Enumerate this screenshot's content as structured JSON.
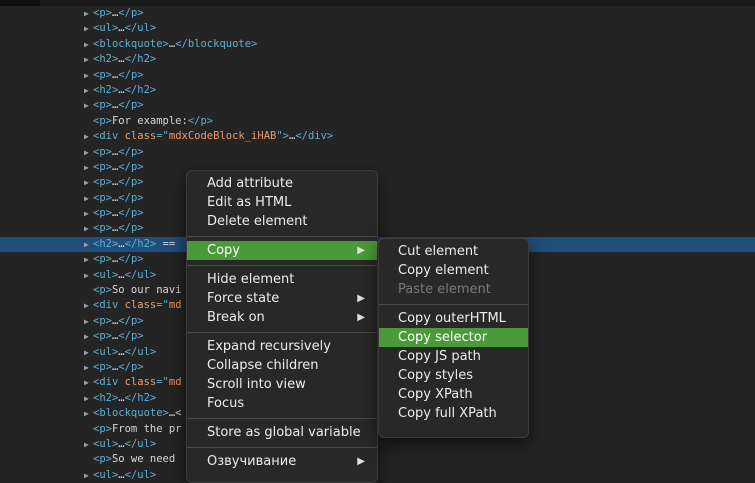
{
  "dom_lines": [
    {
      "arrow": true,
      "parts": [
        [
          "t",
          "<p>"
        ],
        [
          "txt",
          "…"
        ],
        [
          "t",
          "</p>"
        ]
      ]
    },
    {
      "arrow": true,
      "parts": [
        [
          "t",
          "<ul>"
        ],
        [
          "txt",
          "…"
        ],
        [
          "t",
          "</ul>"
        ]
      ]
    },
    {
      "arrow": true,
      "parts": [
        [
          "t",
          "<blockquote>"
        ],
        [
          "txt",
          "…"
        ],
        [
          "t",
          "</blockquote>"
        ]
      ]
    },
    {
      "arrow": true,
      "parts": [
        [
          "t",
          "<h2>"
        ],
        [
          "txt",
          "…"
        ],
        [
          "t",
          "</h2>"
        ]
      ]
    },
    {
      "arrow": true,
      "parts": [
        [
          "t",
          "<p>"
        ],
        [
          "txt",
          "…"
        ],
        [
          "t",
          "</p>"
        ]
      ]
    },
    {
      "arrow": true,
      "parts": [
        [
          "t",
          "<h2>"
        ],
        [
          "txt",
          "…"
        ],
        [
          "t",
          "</h2>"
        ]
      ]
    },
    {
      "arrow": true,
      "parts": [
        [
          "t",
          "<p>"
        ],
        [
          "txt",
          "…"
        ],
        [
          "t",
          "</p>"
        ]
      ]
    },
    {
      "arrow": false,
      "parts": [
        [
          "t",
          "<p>"
        ],
        [
          "txt",
          "For example:"
        ],
        [
          "t",
          "</p>"
        ]
      ]
    },
    {
      "arrow": true,
      "parts": [
        [
          "t",
          "<div "
        ],
        [
          "a",
          "class"
        ],
        [
          "t",
          "=\""
        ],
        [
          "v",
          "mdxCodeBlock_iHAB"
        ],
        [
          "t",
          "\">"
        ],
        [
          "txt",
          "…"
        ],
        [
          "t",
          "</div>"
        ]
      ]
    },
    {
      "arrow": true,
      "parts": [
        [
          "t",
          "<p>"
        ],
        [
          "txt",
          "…"
        ],
        [
          "t",
          "</p>"
        ]
      ]
    },
    {
      "arrow": true,
      "parts": [
        [
          "t",
          "<p>"
        ],
        [
          "txt",
          "…"
        ],
        [
          "t",
          "</p>"
        ]
      ]
    },
    {
      "arrow": true,
      "parts": [
        [
          "t",
          "<p>"
        ],
        [
          "txt",
          "…"
        ],
        [
          "t",
          "</p>"
        ]
      ]
    },
    {
      "arrow": true,
      "parts": [
        [
          "t",
          "<p>"
        ],
        [
          "txt",
          "…"
        ],
        [
          "t",
          "</p>"
        ]
      ]
    },
    {
      "arrow": true,
      "parts": [
        [
          "t",
          "<p>"
        ],
        [
          "txt",
          "…"
        ],
        [
          "t",
          "</p>"
        ]
      ]
    },
    {
      "arrow": true,
      "parts": [
        [
          "t",
          "<p>"
        ],
        [
          "txt",
          "…"
        ],
        [
          "t",
          "</p>"
        ]
      ]
    },
    {
      "arrow": true,
      "selected": true,
      "parts": [
        [
          "t",
          "<h2>"
        ],
        [
          "txt",
          "…"
        ],
        [
          "t",
          "</h2>"
        ],
        [
          "txt",
          " == "
        ]
      ]
    },
    {
      "arrow": true,
      "parts": [
        [
          "t",
          "<p>"
        ],
        [
          "txt",
          "…"
        ],
        [
          "t",
          "</p>"
        ]
      ]
    },
    {
      "arrow": true,
      "parts": [
        [
          "t",
          "<ul>"
        ],
        [
          "txt",
          "…"
        ],
        [
          "t",
          "</ul>"
        ]
      ]
    },
    {
      "arrow": false,
      "parts": [
        [
          "t",
          "<p>"
        ],
        [
          "txt",
          "So our navi"
        ]
      ]
    },
    {
      "arrow": true,
      "parts": [
        [
          "t",
          "<div "
        ],
        [
          "a",
          "class"
        ],
        [
          "t",
          "=\""
        ],
        [
          "v",
          "md"
        ]
      ]
    },
    {
      "arrow": true,
      "parts": [
        [
          "t",
          "<p>"
        ],
        [
          "txt",
          "…"
        ],
        [
          "t",
          "</p>"
        ]
      ]
    },
    {
      "arrow": true,
      "parts": [
        [
          "t",
          "<p>"
        ],
        [
          "txt",
          "…"
        ],
        [
          "t",
          "</p>"
        ]
      ]
    },
    {
      "arrow": true,
      "parts": [
        [
          "t",
          "<ul>"
        ],
        [
          "txt",
          "…"
        ],
        [
          "t",
          "</ul>"
        ]
      ]
    },
    {
      "arrow": true,
      "parts": [
        [
          "t",
          "<p>"
        ],
        [
          "txt",
          "…"
        ],
        [
          "t",
          "</p>"
        ]
      ]
    },
    {
      "arrow": true,
      "parts": [
        [
          "t",
          "<div "
        ],
        [
          "a",
          "class"
        ],
        [
          "t",
          "=\""
        ],
        [
          "v",
          "md"
        ]
      ]
    },
    {
      "arrow": true,
      "parts": [
        [
          "t",
          "<h2>"
        ],
        [
          "txt",
          "…"
        ],
        [
          "t",
          "</h2>"
        ]
      ]
    },
    {
      "arrow": true,
      "parts": [
        [
          "t",
          "<blockquote>"
        ],
        [
          "txt",
          "…<"
        ]
      ]
    },
    {
      "arrow": false,
      "parts": [
        [
          "t",
          "<p>"
        ],
        [
          "txt",
          "From the pr                                      ables:"
        ],
        [
          "t",
          "</p>"
        ]
      ]
    },
    {
      "arrow": true,
      "parts": [
        [
          "t",
          "<ul>"
        ],
        [
          "txt",
          "…"
        ],
        [
          "t",
          "</ul>"
        ]
      ]
    },
    {
      "arrow": false,
      "parts": [
        [
          "t",
          "<p>"
        ],
        [
          "txt",
          "So we need"
        ]
      ]
    },
    {
      "arrow": true,
      "parts": [
        [
          "t",
          "<ul>"
        ],
        [
          "txt",
          "…"
        ],
        [
          "t",
          "</ul>"
        ]
      ]
    }
  ],
  "context_menu": {
    "groups": [
      [
        {
          "label": "Add attribute"
        },
        {
          "label": "Edit as HTML"
        },
        {
          "label": "Delete element"
        }
      ],
      [
        {
          "label": "Copy",
          "submenu": true,
          "highlighted": true
        }
      ],
      [
        {
          "label": "Hide element"
        },
        {
          "label": "Force state",
          "submenu": true
        },
        {
          "label": "Break on",
          "submenu": true
        }
      ],
      [
        {
          "label": "Expand recursively"
        },
        {
          "label": "Collapse children"
        },
        {
          "label": "Scroll into view"
        },
        {
          "label": "Focus"
        }
      ],
      [
        {
          "label": "Store as global variable"
        }
      ],
      [
        {
          "label": "Озвучивание",
          "submenu": true
        }
      ]
    ]
  },
  "copy_submenu": {
    "groups": [
      [
        {
          "label": "Cut element"
        },
        {
          "label": "Copy element"
        },
        {
          "label": "Paste element",
          "disabled": true
        }
      ],
      [
        {
          "label": "Copy outerHTML"
        },
        {
          "label": "Copy selector",
          "highlighted": true
        },
        {
          "label": "Copy JS path"
        },
        {
          "label": "Copy styles"
        },
        {
          "label": "Copy XPath"
        },
        {
          "label": "Copy full XPath"
        }
      ]
    ]
  },
  "icons": {
    "expand_arrow": "triangle-right-icon",
    "submenu_arrow": "submenu-arrow-icon"
  },
  "colors": {
    "background": "#242424",
    "selected_row": "#1f4e7c",
    "menu_highlight": "#4b9a39",
    "tag": "#5db0d7",
    "attribute_name": "#e8a36c",
    "attribute_value": "#f29766"
  }
}
